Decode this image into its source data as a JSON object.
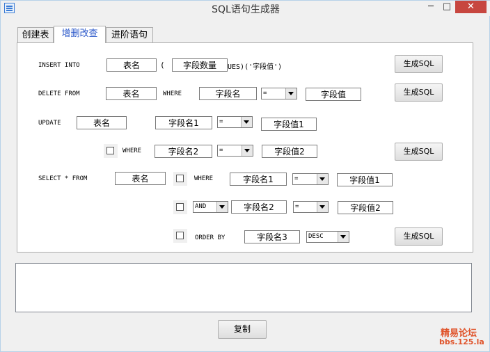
{
  "window": {
    "title": "SQL语句生成器",
    "min": "─",
    "max": "□",
    "close": "✕"
  },
  "tabs": [
    {
      "label": "创建表"
    },
    {
      "label": "增删改查"
    },
    {
      "label": "进阶语句"
    }
  ],
  "insert": {
    "keyword": "INSERT INTO",
    "table": "表名",
    "open_paren": "(",
    "fields": "字段数量",
    "values_tail": "UES)('字段值')",
    "button": "生成SQL"
  },
  "delete": {
    "keyword": "DELETE FROM",
    "table": "表名",
    "where": "WHERE",
    "field": "字段名",
    "op": "=",
    "value": "字段值",
    "button": "生成SQL"
  },
  "update": {
    "keyword": "UPDATE",
    "table": "表名",
    "field1": "字段名1",
    "op1": "=",
    "value1": "字段值1",
    "where": "WHERE",
    "field2": "字段名2",
    "op2": "=",
    "value2": "字段值2",
    "button": "生成SQL"
  },
  "select": {
    "keyword": "SELECT * FROM",
    "table": "表名",
    "where": "WHERE",
    "field1": "字段名1",
    "op1": "=",
    "value1": "字段值1",
    "logic": "AND",
    "field2": "字段名2",
    "op2": "=",
    "value2": "字段值2",
    "orderby": "ORDER BY",
    "field3": "字段名3",
    "order": "DESC",
    "button": "生成SQL"
  },
  "copy_button": "复制",
  "watermark": {
    "line1": "精易论坛",
    "line2": "bbs.125.la"
  }
}
